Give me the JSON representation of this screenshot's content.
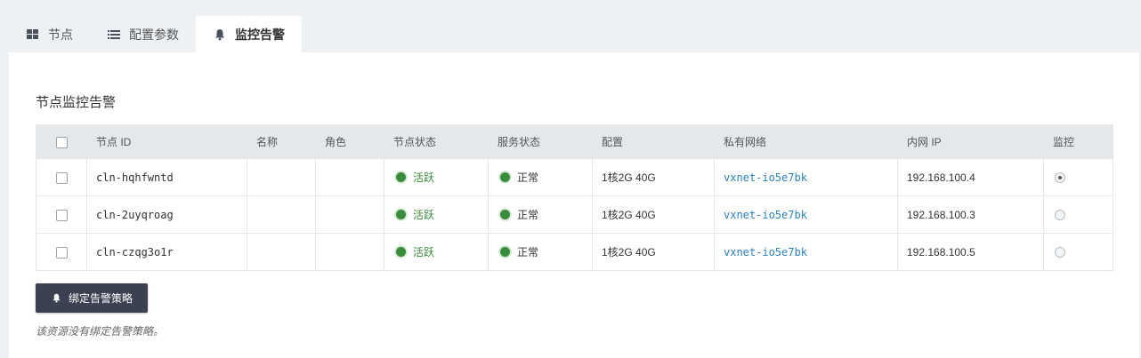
{
  "tabs": [
    {
      "label": "节点",
      "icon": "grid-icon"
    },
    {
      "label": "配置参数",
      "icon": "list-icon"
    },
    {
      "label": "监控告警",
      "icon": "bell-icon",
      "active": true
    }
  ],
  "section_title": "节点监控告警",
  "table": {
    "headers": [
      "",
      "节点 ID",
      "名称",
      "角色",
      "节点状态",
      "服务状态",
      "配置",
      "私有网络",
      "内网 IP",
      "监控"
    ],
    "rows": [
      {
        "id": "cln-hqhfwntd",
        "name": "",
        "role": "",
        "node_status": "活跃",
        "service_status": "正常",
        "config": "1核2G 40G",
        "vxnet": "vxnet-io5e7bk",
        "ip": "192.168.100.4",
        "monitor_selected": true
      },
      {
        "id": "cln-2uyqroag",
        "name": "",
        "role": "",
        "node_status": "活跃",
        "service_status": "正常",
        "config": "1核2G 40G",
        "vxnet": "vxnet-io5e7bk",
        "ip": "192.168.100.3",
        "monitor_selected": false
      },
      {
        "id": "cln-czqg3o1r",
        "name": "",
        "role": "",
        "node_status": "活跃",
        "service_status": "正常",
        "config": "1核2G 40G",
        "vxnet": "vxnet-io5e7bk",
        "ip": "192.168.100.5",
        "monitor_selected": false
      }
    ]
  },
  "bind_button": {
    "label": "绑定告警策略",
    "icon": "bell-icon"
  },
  "note": "该资源没有绑定告警策略。",
  "colors": {
    "active_green": "#3a8b3b",
    "link_blue": "#2b83c2",
    "button_dark": "#3b4150",
    "header_bg": "#e4e8eb"
  }
}
